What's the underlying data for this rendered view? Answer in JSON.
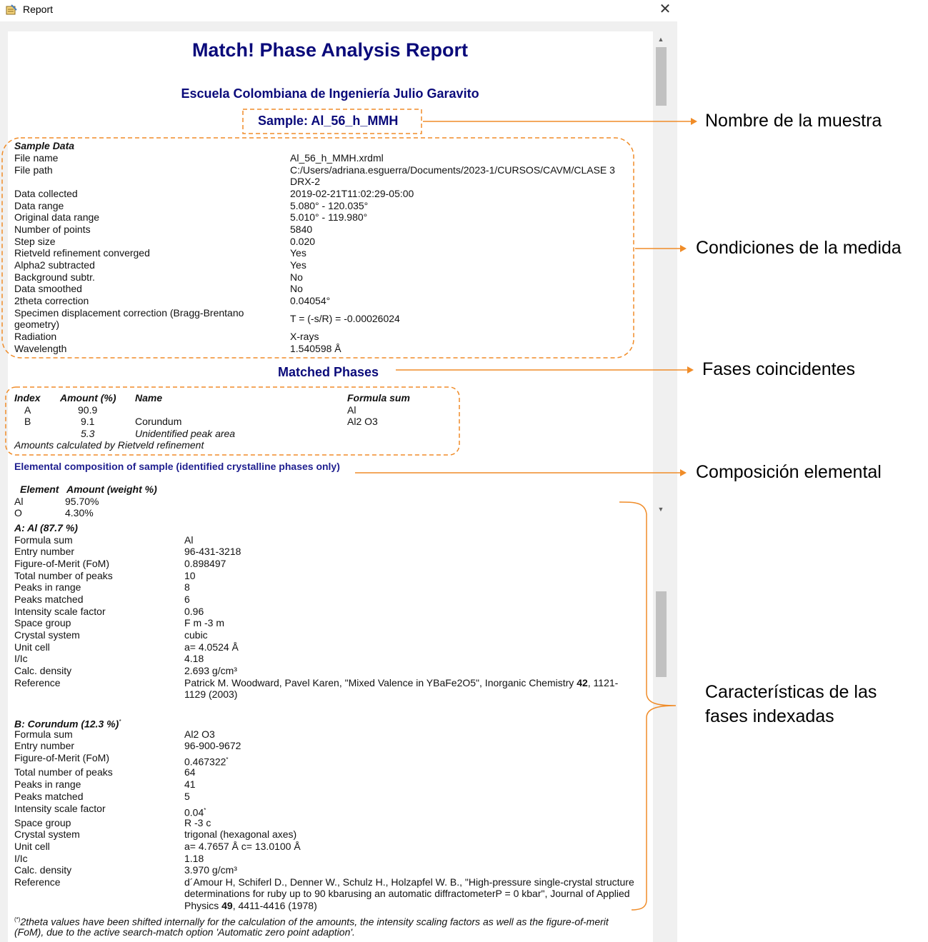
{
  "window": {
    "title": "Report",
    "close_glyph": "✕",
    "icon": "report-icon"
  },
  "scrollbar": {
    "up_glyph": "▲",
    "down_glyph": "▼"
  },
  "report": {
    "title": "Match! Phase Analysis Report",
    "institution": "Escuela Colombiana de Ingeniería Julio Garavito",
    "sample": "Sample: Al_56_h_MMH",
    "sample_data": {
      "heading": "Sample Data",
      "rows": [
        {
          "label": "File name",
          "value": "Al_56_h_MMH.xrdml"
        },
        {
          "label": "File path",
          "value": "C:/Users/adriana.esguerra/Documents/2023-1/CURSOS/CAVM/CLASE 3",
          "value2": "DRX-2"
        },
        {
          "label": "Data collected",
          "value": "2019-02-21T11:02:29-05:00"
        },
        {
          "label": "Data range",
          "value": "5.080° - 120.035°"
        },
        {
          "label": "Original data range",
          "value": "5.010° - 119.980°"
        },
        {
          "label": "Number of points",
          "value": "5840"
        },
        {
          "label": "Step size",
          "value": "0.020"
        },
        {
          "label": "Rietveld refinement converged",
          "value": "Yes"
        },
        {
          "label": "Alpha2 subtracted",
          "value": "Yes"
        },
        {
          "label": "Background subtr.",
          "value": "No"
        },
        {
          "label": "Data smoothed",
          "value": "No"
        },
        {
          "label": "2theta correction",
          "value": "0.04054°"
        },
        {
          "label": "Specimen displacement correction (Bragg-Brentano",
          "label2": "geometry)",
          "value": "T = (-s/R) = -0.00026024"
        },
        {
          "label": "Radiation",
          "value": "X-rays"
        },
        {
          "label": "Wavelength",
          "value": "1.540598 Å"
        }
      ]
    },
    "matched_phases": {
      "heading": "Matched Phases",
      "columns": [
        "Index",
        "Amount (%)",
        "Name",
        "Formula sum"
      ],
      "rows": [
        {
          "index": "A",
          "amount": "90.9",
          "name": "",
          "formula": "Al"
        },
        {
          "index": "B",
          "amount": "9.1",
          "name": "Corundum",
          "formula": "Al2 O3"
        },
        {
          "index": "",
          "amount": "5.3",
          "name": "Unidentified peak area",
          "formula": ""
        }
      ],
      "note": "Amounts calculated by Rietveld refinement"
    },
    "elemental": {
      "heading": "Elemental composition of sample (identified crystalline phases only)",
      "col_element": "Element",
      "col_amount": "Amount (weight %)",
      "rows": [
        {
          "element": "Al",
          "amount": "95.70%"
        },
        {
          "element": "O",
          "amount": "4.30%"
        }
      ]
    },
    "phase_a": {
      "heading": "A: Al (87.7 %)",
      "rows": [
        {
          "label": "Formula sum",
          "value": "Al"
        },
        {
          "label": "Entry number",
          "value": "96-431-3218"
        },
        {
          "label": "Figure-of-Merit (FoM)",
          "value": "0.898497"
        },
        {
          "label": "Total number of peaks",
          "value": "10"
        },
        {
          "label": "Peaks in range",
          "value": "8"
        },
        {
          "label": "Peaks matched",
          "value": "6"
        },
        {
          "label": "Intensity scale factor",
          "value": "0.96"
        },
        {
          "label": "Space group",
          "value": "F m -3 m"
        },
        {
          "label": "Crystal system",
          "value": "cubic"
        },
        {
          "label": "Unit cell",
          "value": "a= 4.0524 Å"
        },
        {
          "label": "I/Ic",
          "value": "4.18"
        },
        {
          "label": "Calc. density",
          "value": "2.693 g/cm³"
        }
      ],
      "reference_label": "Reference",
      "reference_pre": "Patrick M. Woodward, Pavel Karen, \"Mixed Valence in YBaFe2O5\", Inorganic Chemistry ",
      "reference_bold": "42",
      "reference_post": ", 1121-",
      "reference_line2": "1129 (2003)"
    },
    "phase_b": {
      "heading": "B: Corundum (12.3 %)",
      "heading_mark": "*",
      "rows": [
        {
          "label": "Formula sum",
          "value": "Al2 O3"
        },
        {
          "label": "Entry number",
          "value": "96-900-9672"
        },
        {
          "label": "Figure-of-Merit (FoM)",
          "value": "0.467322",
          "mark": "*"
        },
        {
          "label": "Total number of peaks",
          "value": "64"
        },
        {
          "label": "Peaks in range",
          "value": "41"
        },
        {
          "label": "Peaks matched",
          "value": "5"
        },
        {
          "label": "Intensity scale factor",
          "value": "0.04",
          "mark": "*"
        },
        {
          "label": "Space group",
          "value": "R -3 c"
        },
        {
          "label": "Crystal system",
          "value": "trigonal (hexagonal axes)"
        },
        {
          "label": "Unit cell",
          "value": "a= 4.7657 Å  c= 13.0100 Å"
        },
        {
          "label": "I/Ic",
          "value": "1.18"
        },
        {
          "label": "Calc. density",
          "value": "3.970 g/cm³"
        }
      ],
      "reference_label": "Reference",
      "reference_line1": "d´Amour H, Schiferl D., Denner W., Schulz H., Holzapfel W. B., \"High-pressure single-crystal structure",
      "reference_line2": "determinations for ruby up to 90 kbarusing an automatic diffractometerP = 0 kbar\", Journal of Applied",
      "reference_pre3": "Physics ",
      "reference_bold3": "49",
      "reference_post3": ", 4411-4416 (1978)"
    },
    "footnote_mark": "(*)",
    "footnote_line1": "2theta values have been shifted internally for the calculation of the amounts, the intensity scaling factors as well as the figure-of-merit",
    "footnote_line2": "(FoM), due to the active search-match option 'Automatic zero point adaption'."
  },
  "annotations": {
    "sample_name": "Nombre de la muestra",
    "conditions": "Condiciones de la medida",
    "phases": "Fases coincidentes",
    "elemental": "Composición elemental",
    "features_line1": "Características de las",
    "features_line2": "fases indexadas"
  },
  "colors": {
    "heading": "#0a0a7a",
    "annotation_line": "#f08c28"
  }
}
